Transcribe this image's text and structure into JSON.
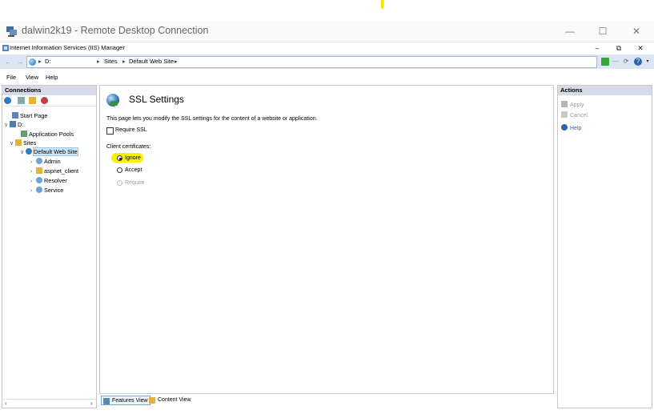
{
  "rdp": {
    "title": "dalwin2k19 - Remote Desktop Connection",
    "minimize": "—",
    "maximize": "☐",
    "close": "✕"
  },
  "iis": {
    "title": "Internet Information Services (IIS) Manager",
    "minimize": "–",
    "maximize": "⧉",
    "close": "✕"
  },
  "address": {
    "segments": [
      "D:",
      "Sites",
      "Default Web Site"
    ]
  },
  "menu": [
    "File",
    "View",
    "Help"
  ],
  "connections": {
    "header": "Connections",
    "tree": [
      {
        "label": "Start Page"
      },
      {
        "label": "D:"
      },
      {
        "label": "Application Pools"
      },
      {
        "label": "Sites"
      },
      {
        "label": "Default Web Site"
      },
      {
        "label": "Admin"
      },
      {
        "label": "aspnet_client"
      },
      {
        "label": "Resolver"
      },
      {
        "label": "Service"
      }
    ]
  },
  "main": {
    "title": "SSL Settings",
    "description": "This page lets you modify the SSL settings for the content of a website or application.",
    "require_ssl": "Require SSL",
    "client_certs_label": "Client certificates:",
    "options": [
      "Ignore",
      "Accept",
      "Require"
    ],
    "selected": "Ignore"
  },
  "view_tabs": [
    "Features View",
    "Content View"
  ],
  "actions": {
    "header": "Actions",
    "apply": "Apply",
    "cancel": "Cancel",
    "help": "Help"
  },
  "colors": {
    "panel_header": "#d6dbe9",
    "address_bar": "#dce6f2",
    "highlight": "#f8f100",
    "link": "#2a64b0"
  }
}
